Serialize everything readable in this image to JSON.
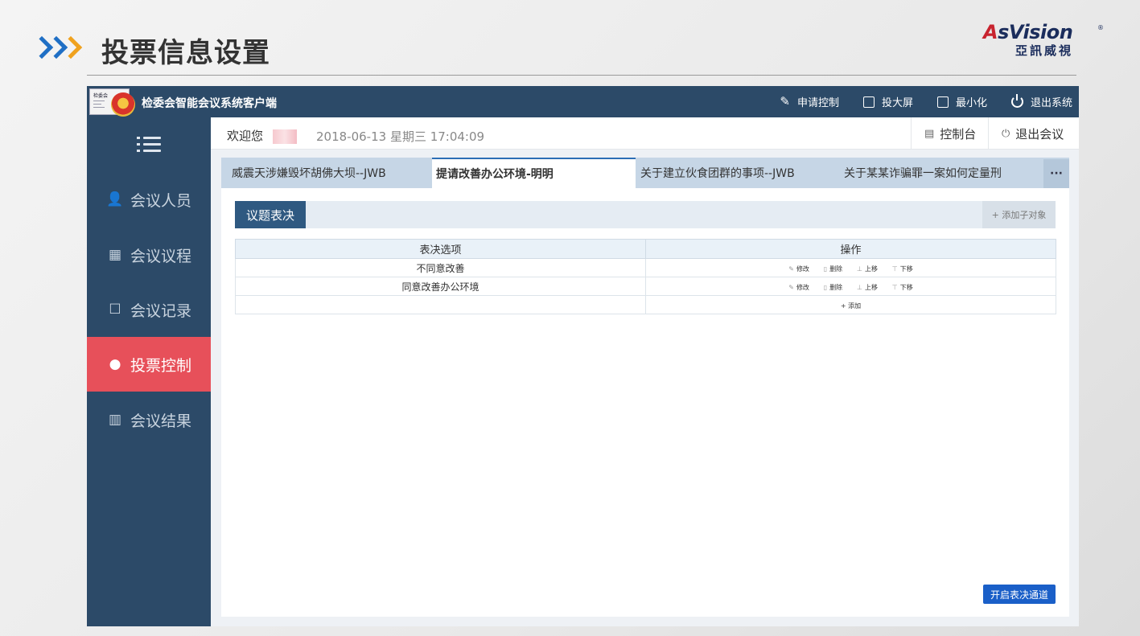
{
  "slide": {
    "title": "投票信息设置",
    "brand_name_part1": "A",
    "brand_name_part2": "sVision",
    "brand_sub": "亞訊威視",
    "brand_reg": "®"
  },
  "app": {
    "logo_label": "检委会",
    "title": "检委会智能会议系统客户端",
    "top_actions": [
      {
        "label": "申请控制",
        "icon": "edit-icon"
      },
      {
        "label": "投大屏",
        "icon": "screen-icon"
      },
      {
        "label": "最小化",
        "icon": "minimize-icon"
      },
      {
        "label": "退出系统",
        "icon": "power-icon"
      }
    ]
  },
  "sidebar": {
    "items": [
      {
        "label": "会议人员",
        "icon": "users-icon",
        "active": false
      },
      {
        "label": "会议议程",
        "icon": "calendar-icon",
        "active": false
      },
      {
        "label": "会议记录",
        "icon": "edit-note-icon",
        "active": false
      },
      {
        "label": "投票控制",
        "icon": "group-icon",
        "active": true
      },
      {
        "label": "会议结果",
        "icon": "bar-chart-icon",
        "active": false
      }
    ]
  },
  "welcome": {
    "label": "欢迎您",
    "datetime": "2018-06-13 星期三 17:04:09",
    "console_label": "控制台",
    "exit_meeting_label": "退出会议"
  },
  "tabs": [
    {
      "label": "威震天涉嫌毁坏胡佛大坝--JWB",
      "active": false
    },
    {
      "label": "提请改善办公环境-明明",
      "active": true
    },
    {
      "label": "关于建立伙食团群的事项--JWB",
      "active": false
    },
    {
      "label": "关于某某诈骗罪一案如何定量刑",
      "active": false
    }
  ],
  "tabs_more": "···",
  "section": {
    "title": "议题表决",
    "add_sub_label": "+ 添加子对象"
  },
  "table": {
    "headers": [
      "表决选项",
      "操作"
    ],
    "rows": [
      {
        "option": "不同意改善"
      },
      {
        "option": "同意改善办公环境"
      }
    ],
    "ops": [
      "修改",
      "删除",
      "上移",
      "下移"
    ],
    "add_label": "+ 添加"
  },
  "open_button": "开启表决通道",
  "colors": {
    "nav_bg": "#2c4a68",
    "active_red": "#e7505a",
    "tab_bar": "#c6d6e6",
    "primary_blue": "#1a5fc8"
  }
}
